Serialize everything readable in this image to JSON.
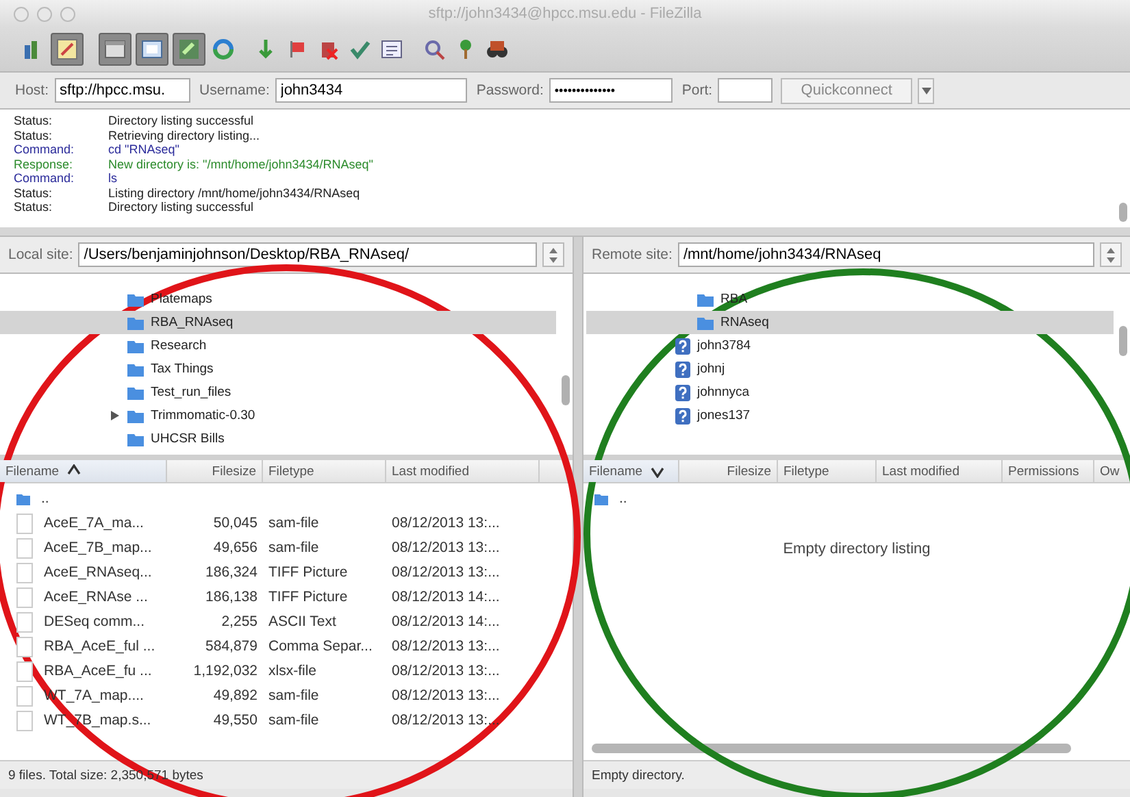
{
  "window": {
    "title": "sftp://john3434@hpcc.msu.edu - FileZilla"
  },
  "quickconnect": {
    "host_label": "Host:",
    "host": "sftp://hpcc.msu.",
    "username_label": "Username:",
    "username": "john3434",
    "password_label": "Password:",
    "password": "••••••••••••••",
    "port_label": "Port:",
    "button": "Quickconnect"
  },
  "log": [
    {
      "kind": "status",
      "label": "Status:",
      "text": "Directory listing successful"
    },
    {
      "kind": "status",
      "label": "Status:",
      "text": "Retrieving directory listing..."
    },
    {
      "kind": "command",
      "label": "Command:",
      "text": "cd \"RNAseq\""
    },
    {
      "kind": "response",
      "label": "Response:",
      "text": "New directory is: \"/mnt/home/john3434/RNAseq\""
    },
    {
      "kind": "command",
      "label": "Command:",
      "text": "ls"
    },
    {
      "kind": "status",
      "label": "Status:",
      "text": "Listing directory /mnt/home/john3434/RNAseq"
    },
    {
      "kind": "status",
      "label": "Status:",
      "text": "Directory listing successful"
    }
  ],
  "local": {
    "site_label": "Local site:",
    "path": "/Users/benjaminjohnson/Desktop/RBA_RNAseq/",
    "tree": [
      {
        "label": "Platemaps",
        "selected": false,
        "expandable": false
      },
      {
        "label": "RBA_RNAseq",
        "selected": true,
        "expandable": false
      },
      {
        "label": "Research",
        "selected": false,
        "expandable": false
      },
      {
        "label": "Tax Things",
        "selected": false,
        "expandable": false
      },
      {
        "label": "Test_run_files",
        "selected": false,
        "expandable": false
      },
      {
        "label": "Trimmomatic-0.30",
        "selected": false,
        "expandable": true
      },
      {
        "label": "UHCSR Bills",
        "selected": false,
        "expandable": false
      }
    ],
    "columns": [
      {
        "label": "Filename",
        "sorted": true,
        "descending": false
      },
      {
        "label": "Filesize",
        "sorted": false
      },
      {
        "label": "Filetype",
        "sorted": false
      },
      {
        "label": "Last modified",
        "sorted": false
      }
    ],
    "rows": [
      {
        "kind": "parent",
        "name": ".."
      },
      {
        "kind": "file",
        "name": "AceE_7A_ma...",
        "size": "50,045",
        "type": "sam-file",
        "modified": "08/12/2013 13:..."
      },
      {
        "kind": "file",
        "name": "AceE_7B_map...",
        "size": "49,656",
        "type": "sam-file",
        "modified": "08/12/2013 13:..."
      },
      {
        "kind": "file",
        "name": "AceE_RNAseq...",
        "size": "186,324",
        "type": "TIFF Picture",
        "modified": "08/12/2013 13:..."
      },
      {
        "kind": "file",
        "name": "AceE_RNAse ...",
        "size": "186,138",
        "type": "TIFF Picture",
        "modified": "08/12/2013 14:..."
      },
      {
        "kind": "file",
        "name": "DESeq comm...",
        "size": "2,255",
        "type": "ASCII Text",
        "modified": "08/12/2013 14:..."
      },
      {
        "kind": "file",
        "name": "RBA_AceE_ful ...",
        "size": "584,879",
        "type": "Comma Separ...",
        "modified": "08/12/2013 13:..."
      },
      {
        "kind": "file",
        "name": "RBA_AceE_fu ...",
        "size": "1,192,032",
        "type": "xlsx-file",
        "modified": "08/12/2013 13:..."
      },
      {
        "kind": "file",
        "name": "WT_7A_map....",
        "size": "49,892",
        "type": "sam-file",
        "modified": "08/12/2013 13:..."
      },
      {
        "kind": "file",
        "name": "WT_7B_map.s...",
        "size": "49,550",
        "type": "sam-file",
        "modified": "08/12/2013 13:..."
      }
    ],
    "status": "9 files. Total size: 2,350,571 bytes"
  },
  "remote": {
    "site_label": "Remote site:",
    "path": "/mnt/home/john3434/RNAseq",
    "tree": [
      {
        "children": [
          {
            "kind": "folder",
            "label": "RBA",
            "selected": false
          },
          {
            "kind": "folder",
            "label": "RNAseq",
            "selected": true
          }
        ]
      },
      {
        "kind": "unknown",
        "label": "john3784",
        "selected": false
      },
      {
        "kind": "unknown",
        "label": "johnj",
        "selected": false
      },
      {
        "kind": "unknown",
        "label": "johnnyca",
        "selected": false
      },
      {
        "kind": "unknown",
        "label": "jones137",
        "selected": false
      }
    ],
    "columns": [
      {
        "label": "Filename",
        "sorted": true,
        "descending": true
      },
      {
        "label": "Filesize",
        "sorted": false
      },
      {
        "label": "Filetype",
        "sorted": false
      },
      {
        "label": "Last modified",
        "sorted": false
      },
      {
        "label": "Permissions",
        "sorted": false
      },
      {
        "label": "Ow",
        "sorted": false
      }
    ],
    "rows": [
      {
        "kind": "parent",
        "name": ".."
      }
    ],
    "empty_message": "Empty directory listing",
    "status": "Empty directory."
  },
  "annotations": [
    {
      "kind": "circle",
      "color": "#e01419"
    },
    {
      "kind": "circle",
      "color": "#1f7f1f"
    }
  ]
}
